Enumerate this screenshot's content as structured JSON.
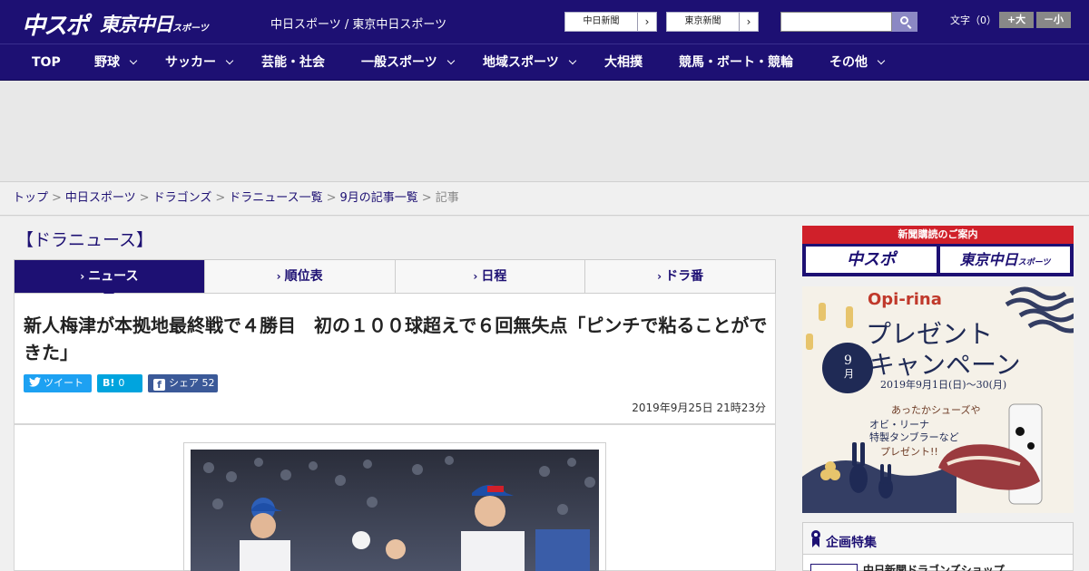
{
  "header": {
    "logo_primary": "中スポ",
    "logo_secondary": "東京中日",
    "logo_secondary_small": "スポーツ",
    "tagline": "中日スポーツ / 東京中日スポーツ",
    "paper_links": [
      {
        "label": "中日新聞",
        "arrow": "›"
      },
      {
        "label": "東京新聞",
        "arrow": "›"
      }
    ],
    "search_placeholder": "",
    "font_size_label": "文字（0）",
    "font_larger": "+大",
    "font_smaller": "－小"
  },
  "nav": {
    "items": [
      {
        "label": "TOP"
      },
      {
        "label": "野球"
      },
      {
        "label": "サッカー"
      },
      {
        "label": "芸能・社会"
      },
      {
        "label": "一般スポーツ"
      },
      {
        "label": "地域スポーツ"
      },
      {
        "label": "大相撲"
      },
      {
        "label": "競馬・ボート・競輪"
      },
      {
        "label": "その他"
      }
    ]
  },
  "breadcrumb": {
    "items": [
      "トップ",
      "中日スポーツ",
      "ドラゴンズ",
      "ドラニュース一覧",
      "9月の記事一覧"
    ],
    "current": "記事",
    "separator": ">"
  },
  "section": {
    "heading": "【ドラニュース】"
  },
  "tabs": [
    {
      "label": "ニュース",
      "caret": "›"
    },
    {
      "label": "順位表",
      "caret": "›"
    },
    {
      "label": "日程",
      "caret": "›"
    },
    {
      "label": "ドラ番",
      "caret": "›"
    }
  ],
  "article": {
    "title": "新人梅津が本拠地最終戦で４勝目　初の１００球超えで６回無失点「ピンチで粘ることができた」",
    "date": "2019年9月25日 21時23分",
    "share": {
      "tweet_label": "ツイート",
      "hatena_glyph": "B!",
      "hatena_count": "0",
      "facebook_glyph": "f",
      "facebook_label": "シェア",
      "facebook_count": "52"
    }
  },
  "sidebar": {
    "subscribe_head": "新聞購読のご案内",
    "subscribe_logo_1": "中スポ",
    "subscribe_logo_2": "東京中日",
    "subscribe_logo_2_small": "スポーツ",
    "promo": {
      "brand": "Opi-rina",
      "title_1": "プレゼント",
      "title_2": "キャンペーン",
      "month": "9",
      "month_suffix": "月",
      "period": "2019年9月1日(日)〜30(月)",
      "copy_1": "あったかシューズや",
      "copy_2": "オビ・リーナ",
      "copy_3": "特製タンブラーなど",
      "copy_4": "プレゼント!!"
    },
    "feature_title": "企画特集",
    "feature_item": "中日新聞ドラゴンズショップ"
  },
  "colors": {
    "brand_navy": "#1d1073",
    "twitter": "#1da1f2",
    "hatena": "#00a4de",
    "facebook": "#3b5998",
    "subscribe_red": "#d0202a"
  },
  "icons": [
    "search-icon",
    "twitter-icon",
    "facebook-icon",
    "ribbon-icon",
    "chevron-down-icon"
  ]
}
